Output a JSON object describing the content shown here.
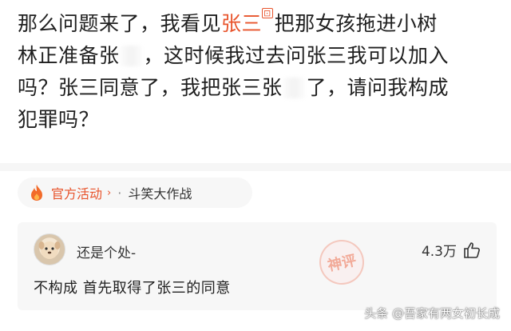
{
  "post": {
    "line1_a": "那么问题来了，我看见",
    "mention": "张三",
    "mention_tag": "ꁍ",
    "line1_b": "把那女孩拖进小树",
    "line2_a": "林正准备张",
    "line2_b": "，这时候我过去问张三我可以加入",
    "line3_a": "吗？张三同意了，我把张三张",
    "line3_b": "了，请问我构成",
    "line4": "犯罪吗？"
  },
  "activity": {
    "official_label": "官方活动",
    "chevron": "›",
    "separator": "·",
    "topic": "斗笑大作战"
  },
  "comment": {
    "username": "还是个处-",
    "likes": "4.3万",
    "text": "不构成 首先取得了张三的同意"
  },
  "stamp_text": "神评",
  "watermark": "头条 @吾家有两女初长成",
  "colors": {
    "accent": "#e8542c",
    "background": "#ffffff",
    "panel": "#f7f7f7"
  }
}
